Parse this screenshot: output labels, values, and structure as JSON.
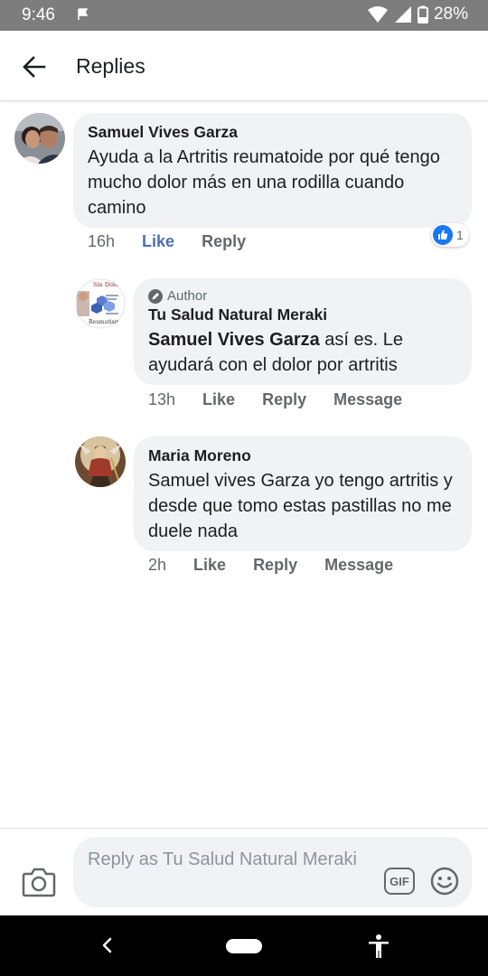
{
  "status_bar": {
    "time": "9:46",
    "battery": "28%"
  },
  "header": {
    "title": "Replies"
  },
  "comments": [
    {
      "author": "Samuel Vives Garza",
      "text": "Ayuda a la Artritis reumatoide por qué tengo mucho dolor más en una rodilla cuando camino",
      "time": "16h",
      "like_label": "Like",
      "reply_label": "Reply",
      "reaction_count": "1"
    },
    {
      "badge": "Author",
      "author": "Tu Salud Natural Meraki",
      "mention": "Samuel Vives Garza",
      "text": " así es. Le ayudará con el dolor por artritis",
      "time": "13h",
      "like_label": "Like",
      "reply_label": "Reply",
      "message_label": "Message",
      "avatar_text": "Sin Dolor",
      "avatar_subtext": "Reumatismo"
    },
    {
      "author": "Maria Moreno",
      "text": "Samuel vives Garza yo tengo artritis y desde que tomo estas pastillas no me duele nada",
      "time": "2h",
      "like_label": "Like",
      "reply_label": "Reply",
      "message_label": "Message"
    }
  ],
  "composer": {
    "placeholder": "Reply as Tu Salud Natural Meraki",
    "gif_label": "GIF"
  },
  "colors": {
    "like_active": "#4b6fb8",
    "bubble_bg": "#f0f2f5",
    "status_bar_bg": "#7d7d7d",
    "reaction_blue": "#1877f2"
  },
  "icons": {
    "back": "arrow-left-icon",
    "camera": "camera-icon",
    "emoji": "smiley-icon",
    "like_reaction": "thumbs-up-icon",
    "author_badge": "pencil-icon"
  }
}
